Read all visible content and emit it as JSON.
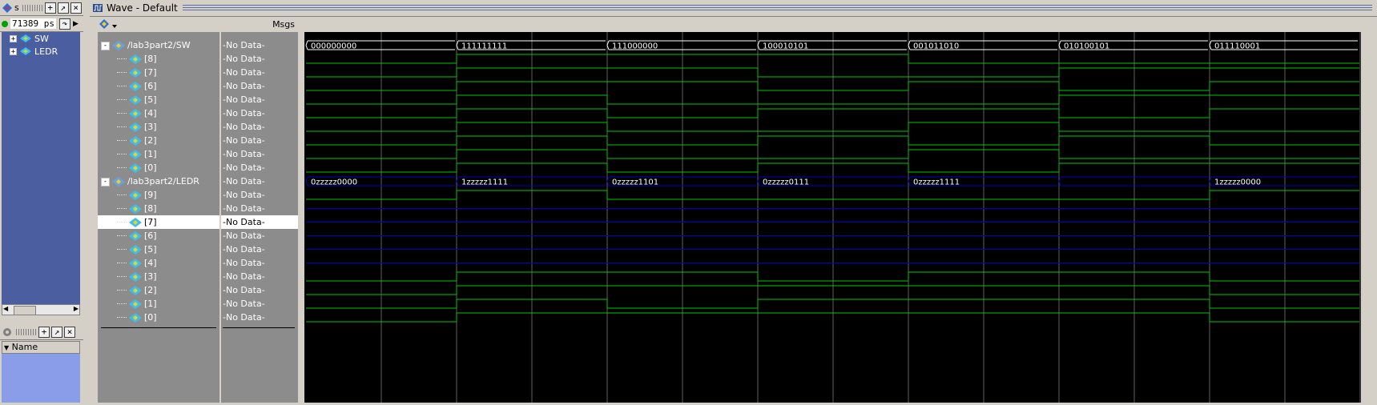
{
  "left_dock": {
    "panel_title": "s",
    "time_readout": "71389 ps",
    "tree": [
      {
        "label": "SW"
      },
      {
        "label": "LEDR"
      }
    ],
    "objects_header": "Name"
  },
  "wave_window": {
    "title": "Wave - Default",
    "msgs_header": "Msgs",
    "signals": [
      {
        "name": "/lab3part2/SW",
        "value": "-No Data-",
        "type": "bus_root"
      },
      {
        "name": "[8]",
        "value": "-No Data-",
        "type": "bit"
      },
      {
        "name": "[7]",
        "value": "-No Data-",
        "type": "bit"
      },
      {
        "name": "[6]",
        "value": "-No Data-",
        "type": "bit"
      },
      {
        "name": "[5]",
        "value": "-No Data-",
        "type": "bit"
      },
      {
        "name": "[4]",
        "value": "-No Data-",
        "type": "bit"
      },
      {
        "name": "[3]",
        "value": "-No Data-",
        "type": "bit"
      },
      {
        "name": "[2]",
        "value": "-No Data-",
        "type": "bit"
      },
      {
        "name": "[1]",
        "value": "-No Data-",
        "type": "bit"
      },
      {
        "name": "[0]",
        "value": "-No Data-",
        "type": "bit"
      },
      {
        "name": "/lab3part2/LEDR",
        "value": "-No Data-",
        "type": "bus_root"
      },
      {
        "name": "[9]",
        "value": "-No Data-",
        "type": "bit"
      },
      {
        "name": "[8]",
        "value": "-No Data-",
        "type": "bit"
      },
      {
        "name": "[7]",
        "value": "-No Data-",
        "type": "bit",
        "selected": true
      },
      {
        "name": "[6]",
        "value": "-No Data-",
        "type": "bit"
      },
      {
        "name": "[5]",
        "value": "-No Data-",
        "type": "bit"
      },
      {
        "name": "[4]",
        "value": "-No Data-",
        "type": "bit"
      },
      {
        "name": "[3]",
        "value": "-No Data-",
        "type": "bit"
      },
      {
        "name": "[2]",
        "value": "-No Data-",
        "type": "bit"
      },
      {
        "name": "[1]",
        "value": "-No Data-",
        "type": "bit"
      },
      {
        "name": "[0]",
        "value": "-No Data-",
        "type": "bit"
      }
    ],
    "sw_bus_values": [
      "000000000",
      "111111111",
      "111000000",
      "100010101",
      "001011010",
      "010100101",
      "011110001"
    ],
    "ledr_bus_values": [
      "0zzzzz0000",
      "1zzzzz1111",
      "0zzzzz1101",
      "0zzzzz0111",
      "0zzzzz1111",
      "0zzzzz1111",
      "1zzzzz0000"
    ],
    "ledr_bus_labels_shown": [
      true,
      true,
      true,
      true,
      true,
      false,
      true
    ],
    "colors": {
      "wave_bg": "#000000",
      "wave_green": "#00c800",
      "hiz_blue": "#0000c8",
      "grid": "#606060",
      "tree_bg": "#4a5ea0",
      "objects_bg": "#8a9de8"
    }
  }
}
